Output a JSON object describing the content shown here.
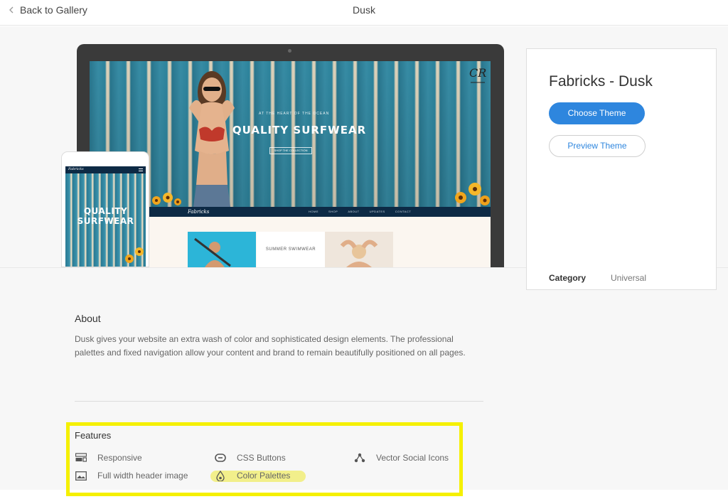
{
  "topbar": {
    "back_label": "Back to Gallery",
    "title": "Dusk"
  },
  "preview": {
    "hero_tagline": "AT THE HEART OF THE OCEAN",
    "hero_title": "QUALITY SURFWEAR",
    "hero_button": "SHOP THE COLLECTION",
    "brand": "Fabricks",
    "nav_links": [
      "HOME",
      "SHOP",
      "ABOUT",
      "UPDATES",
      "CONTACT"
    ],
    "tile_label": "SUMMER SWIMWEAR",
    "phone_brand": "Fabricks",
    "phone_title": "QUALITY SURFWEAR"
  },
  "card": {
    "title": "Fabricks - Dusk",
    "choose_label": "Choose Theme",
    "preview_label": "Preview Theme",
    "category_label": "Category",
    "category_value": "Universal"
  },
  "about": {
    "heading": "About",
    "text": "Dusk gives your website an extra wash of color and sophisticated design elements. The professional palettes and fixed navigation allow your content and brand to remain beautifully positioned on all pages."
  },
  "features": {
    "heading": "Features",
    "items": [
      {
        "label": "Responsive",
        "icon": "responsive-icon"
      },
      {
        "label": "CSS Buttons",
        "icon": "css-buttons-icon"
      },
      {
        "label": "Vector Social Icons",
        "icon": "vector-social-icon"
      },
      {
        "label": "Full width header image",
        "icon": "header-image-icon"
      },
      {
        "label": "Color Palettes",
        "icon": "color-drop-icon"
      }
    ]
  },
  "colors": {
    "accent": "#2e86de",
    "highlight_box": "#f5f000",
    "highlight_pill": "#f2ef8b",
    "navy": "#0d2a45"
  }
}
